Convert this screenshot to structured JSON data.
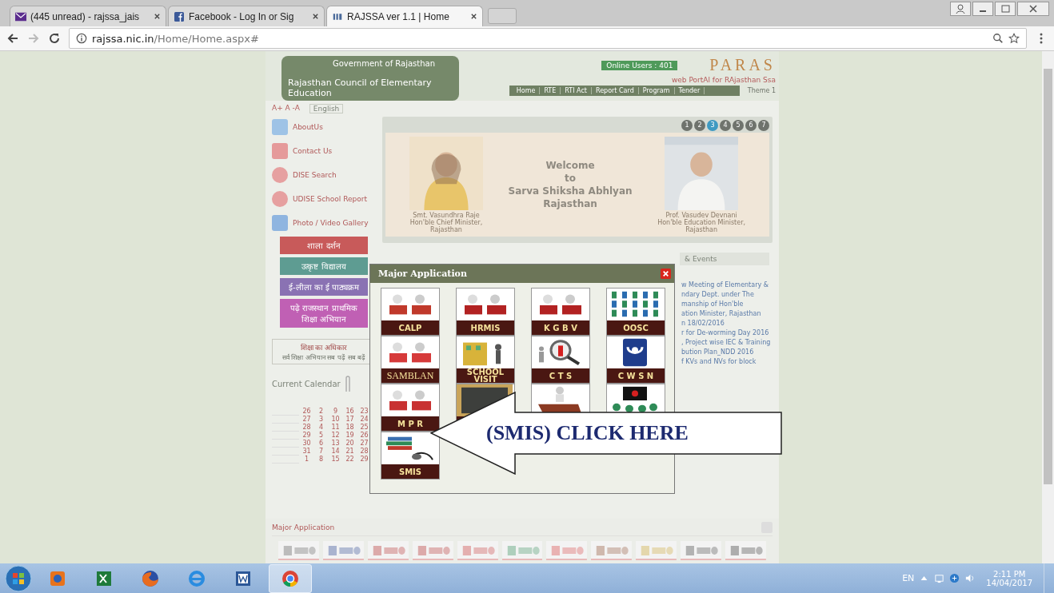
{
  "browser": {
    "tabs": [
      {
        "title": "(445 unread) - rajssa_jais",
        "kind": "mail",
        "selected": false
      },
      {
        "title": "Facebook - Log In or Sig",
        "kind": "social",
        "selected": false
      },
      {
        "title": "RAJSSA ver 1.1 | Home",
        "kind": "site",
        "selected": true
      }
    ],
    "url": {
      "host": "rajssa.nic.in",
      "path": "/Home/Home.aspx#"
    }
  },
  "header": {
    "gov_title": "Government of Rajasthan",
    "council_title": "Rajasthan Council of Elementary Education",
    "online_users": "Online Users : 401",
    "logo": "PARAS",
    "tagline": "web PortAl for RAjasthan Ssa",
    "nav": [
      "Home",
      "RTE",
      "RTI Act",
      "Report Card",
      "Program",
      "Tender"
    ],
    "theme": "Theme 1",
    "font_sizes": "A+ A -A",
    "language": "English"
  },
  "sidebar": {
    "links": [
      {
        "label": "AboutUs",
        "kind": "about"
      },
      {
        "label": "Contact Us",
        "kind": "contact"
      },
      {
        "label": "DISE Search",
        "kind": "search"
      },
      {
        "label": "UDISE School Report",
        "kind": "search"
      },
      {
        "label": "Photo / Video Gallery",
        "kind": "video"
      }
    ],
    "banners": [
      {
        "text": "शाला दर्शन",
        "color": "#c85a5a"
      },
      {
        "text": "उत्कृष्ट विद्यालय",
        "color": "#5e9c92"
      },
      {
        "text": "ई-लीला का ई पाठ्यक्रम",
        "color": "#8a72b3"
      },
      {
        "text": "पढ़े राजस्थान प्राथमिक शिक्षा अभियान",
        "color": "#c060b4"
      }
    ],
    "rte": {
      "title": "शिक्षा का अधिकार",
      "subtitle": "सर्व शिक्षा अभियान सब पढ़ें सब बढ़ें"
    },
    "calendar_title": "Current Calendar",
    "calendar": [
      [
        "26",
        "2",
        "9",
        "16",
        "23"
      ],
      [
        "27",
        "3",
        "10",
        "17",
        "24"
      ],
      [
        "28",
        "4",
        "11",
        "18",
        "25"
      ],
      [
        "29",
        "5",
        "12",
        "19",
        "26"
      ],
      [
        "30",
        "6",
        "13",
        "20",
        "27"
      ],
      [
        "31",
        "7",
        "14",
        "21",
        "28"
      ],
      [
        "1",
        "8",
        "15",
        "22",
        "29"
      ]
    ]
  },
  "slider": {
    "pages": [
      {
        "label": "1",
        "selected": false
      },
      {
        "label": "2",
        "selected": false
      },
      {
        "label": "3",
        "selected": true
      },
      {
        "label": "4",
        "selected": false
      },
      {
        "label": "5",
        "selected": false
      },
      {
        "label": "6",
        "selected": false
      },
      {
        "label": "7",
        "selected": false
      }
    ],
    "welcome": [
      "Welcome",
      "to",
      "Sarva Shiksha Abhlyan",
      "Rajasthan"
    ],
    "captions": [
      [
        "Smt. Vasundhra Raje",
        "Hon'ble Chief Minister,",
        "Rajasthan"
      ],
      [
        "Prof. Vasudev Devnani",
        "Hon'ble Education Minister,",
        "Rajasthan"
      ]
    ]
  },
  "news": {
    "tab": "& Events",
    "lines": [
      "w Meeting of Elementary &",
      "ndary Dept. under The",
      "manship of Hon'ble",
      "ation Minister, Rajasthan",
      "n 18/02/2016",
      "r for De-worming Day 2016",
      ", Project wise IEC & Training",
      "bution Plan_NDD 2016",
      "f KVs and NVs for block"
    ]
  },
  "modal": {
    "title": "Major Application",
    "apps": [
      {
        "label": "CALP",
        "kind": "people"
      },
      {
        "label": "HRMIS",
        "kind": "crowd"
      },
      {
        "label": "K G B V",
        "kind": "crowd"
      },
      {
        "label": "OOSC",
        "kind": "grid"
      },
      {
        "label": "SAMBLAN",
        "kind": "chart"
      },
      {
        "label": "SCHOOL VISIT",
        "kind": "building"
      },
      {
        "label": "C T S",
        "kind": "magnifier"
      },
      {
        "label": "C W S N",
        "kind": "hands"
      },
      {
        "label": "M P R",
        "kind": "steps"
      },
      {
        "kind": "board"
      },
      {
        "kind": "desk"
      },
      {
        "kind": "screen"
      },
      {
        "label": "SMIS",
        "kind": "books"
      }
    ]
  },
  "callout": "(SMIS) CLICK HERE",
  "bottom": {
    "title": "Major Application",
    "thumbs": [
      {
        "kind": "magnifier"
      },
      {
        "kind": "hands"
      },
      {
        "kind": "crowd"
      },
      {
        "kind": "crowd"
      },
      {
        "kind": "steps"
      },
      {
        "kind": "grid"
      },
      {
        "kind": "chart"
      },
      {
        "kind": "desk"
      },
      {
        "kind": "building"
      },
      {
        "kind": "board"
      },
      {
        "kind": "screen"
      }
    ]
  },
  "taskbar": {
    "apps": [
      {
        "kind": "media",
        "selected": false
      },
      {
        "kind": "excel",
        "selected": false
      },
      {
        "kind": "firefox",
        "selected": false
      },
      {
        "kind": "ie",
        "selected": false
      },
      {
        "kind": "word",
        "selected": false
      },
      {
        "kind": "chrome",
        "selected": true
      }
    ],
    "language": "EN",
    "time": "2:11 PM",
    "date": "14/04/2017"
  }
}
